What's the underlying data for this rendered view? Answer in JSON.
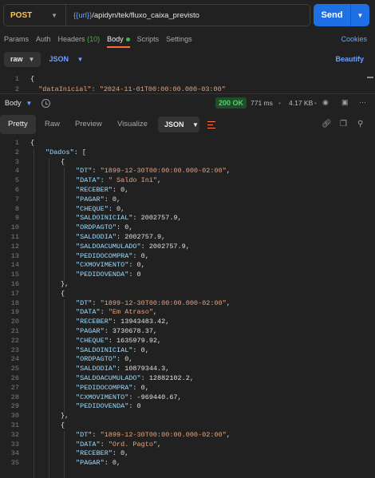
{
  "request": {
    "method": "POST",
    "url_var": "{{url}}",
    "url_path": "/apidyn/tek/fluxo_caixa_previsto",
    "send_label": "Send"
  },
  "req_tabs": {
    "params": "Params",
    "auth": "Auth",
    "headers": "Headers",
    "headers_count": "(10)",
    "body": "Body",
    "scripts": "Scripts",
    "settings": "Settings",
    "cookies": "Cookies"
  },
  "body_opts": {
    "mode": "raw",
    "format": "JSON",
    "beautify": "Beautify"
  },
  "req_body": {
    "lines": [
      {
        "n": "1",
        "text": "{"
      },
      {
        "n": "2",
        "text": "  \"dataInicial\": \"2024-11-01T00:00:00.000-03:00\""
      }
    ]
  },
  "response": {
    "body_label": "Body",
    "status": "200 OK",
    "time": "771 ms",
    "size": "4.17 KB",
    "tabs": {
      "pretty": "Pretty",
      "raw": "Raw",
      "preview": "Preview",
      "visualize": "Visualize"
    },
    "format": "JSON"
  },
  "colors": {
    "accent": "#ff6c37",
    "send": "#1f6fe5",
    "status": "#4fd36b",
    "method": "#ffc44d"
  },
  "lines": [
    {
      "n": "1",
      "i": 0,
      "t": "p",
      "v": "{"
    },
    {
      "n": "2",
      "i": 1,
      "t": "kv",
      "k": "\"Dados\"",
      "v": "["
    },
    {
      "n": "3",
      "i": 2,
      "t": "p",
      "v": "{"
    },
    {
      "n": "4",
      "i": 3,
      "t": "kv",
      "k": "\"DT\"",
      "s": "\"1899-12-30T00:00:00.000-02:00\"",
      "v": ","
    },
    {
      "n": "5",
      "i": 3,
      "t": "kv",
      "k": "\"DATA\"",
      "s": "\" Saldo Ini\"",
      "v": ","
    },
    {
      "n": "6",
      "i": 3,
      "t": "kv",
      "k": "\"RECEBER\"",
      "v": "0,"
    },
    {
      "n": "7",
      "i": 3,
      "t": "kv",
      "k": "\"PAGAR\"",
      "v": "0,"
    },
    {
      "n": "8",
      "i": 3,
      "t": "kv",
      "k": "\"CHEQUE\"",
      "v": "0,"
    },
    {
      "n": "9",
      "i": 3,
      "t": "kv",
      "k": "\"SALDOINICIAL\"",
      "v": "2002757.9,"
    },
    {
      "n": "10",
      "i": 3,
      "t": "kv",
      "k": "\"ORDPAGTO\"",
      "v": "0,"
    },
    {
      "n": "11",
      "i": 3,
      "t": "kv",
      "k": "\"SALDODIA\"",
      "v": "2002757.9,"
    },
    {
      "n": "12",
      "i": 3,
      "t": "kv",
      "k": "\"SALDOACUMULADO\"",
      "v": "2002757.9,"
    },
    {
      "n": "13",
      "i": 3,
      "t": "kv",
      "k": "\"PEDIDOCOMPRA\"",
      "v": "0,"
    },
    {
      "n": "14",
      "i": 3,
      "t": "kv",
      "k": "\"CXMOVIMENTO\"",
      "v": "0,"
    },
    {
      "n": "15",
      "i": 3,
      "t": "kv",
      "k": "\"PEDIDOVENDA\"",
      "v": "0"
    },
    {
      "n": "16",
      "i": 2,
      "t": "p",
      "v": "},"
    },
    {
      "n": "17",
      "i": 2,
      "t": "p",
      "v": "{"
    },
    {
      "n": "18",
      "i": 3,
      "t": "kv",
      "k": "\"DT\"",
      "s": "\"1899-12-30T00:00:00.000-02:00\"",
      "v": ","
    },
    {
      "n": "19",
      "i": 3,
      "t": "kv",
      "k": "\"DATA\"",
      "s": "\"Em Atraso\"",
      "v": ","
    },
    {
      "n": "20",
      "i": 3,
      "t": "kv",
      "k": "\"RECEBER\"",
      "v": "13943483.42,"
    },
    {
      "n": "21",
      "i": 3,
      "t": "kv",
      "k": "\"PAGAR\"",
      "v": "3730678.37,"
    },
    {
      "n": "22",
      "i": 3,
      "t": "kv",
      "k": "\"CHEQUE\"",
      "v": "1635979.92,"
    },
    {
      "n": "23",
      "i": 3,
      "t": "kv",
      "k": "\"SALDOINICIAL\"",
      "v": "0,"
    },
    {
      "n": "24",
      "i": 3,
      "t": "kv",
      "k": "\"ORDPAGTO\"",
      "v": "0,"
    },
    {
      "n": "25",
      "i": 3,
      "t": "kv",
      "k": "\"SALDODIA\"",
      "v": "10879344.3,"
    },
    {
      "n": "26",
      "i": 3,
      "t": "kv",
      "k": "\"SALDOACUMULADO\"",
      "v": "12882102.2,"
    },
    {
      "n": "27",
      "i": 3,
      "t": "kv",
      "k": "\"PEDIDOCOMPRA\"",
      "v": "0,"
    },
    {
      "n": "28",
      "i": 3,
      "t": "kv",
      "k": "\"CXMOVIMENTO\"",
      "v": "-969440.67,"
    },
    {
      "n": "29",
      "i": 3,
      "t": "kv",
      "k": "\"PEDIDOVENDA\"",
      "v": "0"
    },
    {
      "n": "30",
      "i": 2,
      "t": "p",
      "v": "},"
    },
    {
      "n": "31",
      "i": 2,
      "t": "p",
      "v": "{"
    },
    {
      "n": "32",
      "i": 3,
      "t": "kv",
      "k": "\"DT\"",
      "s": "\"1899-12-30T00:00:00.000-02:00\"",
      "v": ","
    },
    {
      "n": "33",
      "i": 3,
      "t": "kv",
      "k": "\"DATA\"",
      "s": "\"Ord. Pagto\"",
      "v": ","
    },
    {
      "n": "34",
      "i": 3,
      "t": "kv",
      "k": "\"RECEBER\"",
      "v": "0,"
    },
    {
      "n": "35",
      "i": 3,
      "t": "kv",
      "k": "\"PAGAR\"",
      "v": "0,"
    }
  ]
}
